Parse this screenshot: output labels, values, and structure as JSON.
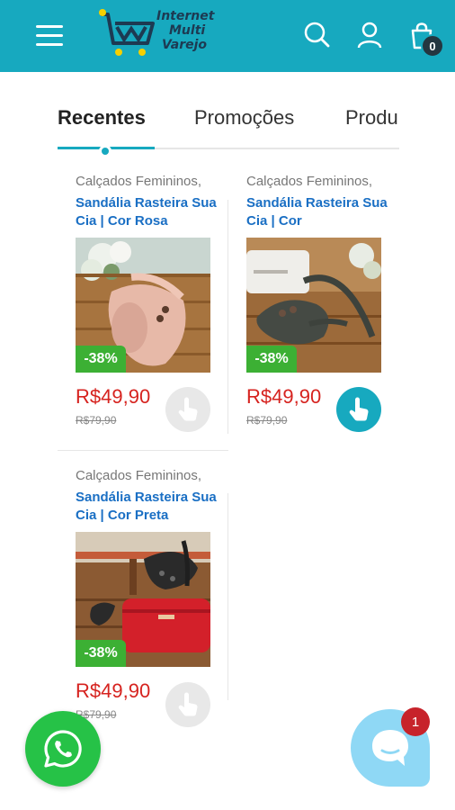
{
  "header": {
    "logo_line1": "Internet",
    "logo_line2": "Multi",
    "logo_line3": "Varejo",
    "cart_count": "0",
    "bg_color": "#17a9bf"
  },
  "tabs": [
    {
      "label": "Recentes",
      "active": true
    },
    {
      "label": "Promoções",
      "active": false
    },
    {
      "label": "Produ",
      "active": false
    }
  ],
  "products": [
    {
      "category": "Calçados Femininos,",
      "title": "Sandália Rasteira Sua Cia | Cor Rosa",
      "discount": "-38%",
      "price": "R$49,90",
      "old_price": "R$79,90",
      "button_state": "disabled",
      "image": "pink-sandal-photo"
    },
    {
      "category": "Calçados Femininos,",
      "title": "Sandália Rasteira Sua Cia | Cor",
      "discount": "-38%",
      "price": "R$49,90",
      "old_price": "R$79,90",
      "button_state": "enabled",
      "image": "dark-sandal-photo"
    },
    {
      "category": "Calçados Femininos,",
      "title": "Sandália Rasteira Sua Cia | Cor Preta",
      "discount": "-38%",
      "price": "R$49,90",
      "old_price": "R$79,90",
      "button_state": "disabled",
      "image": "black-sandal-photo"
    }
  ],
  "floating": {
    "whatsapp_icon": "whatsapp-icon",
    "chat_icon": "chat-bubble-icon",
    "chat_badge": "1"
  },
  "colors": {
    "accent": "#17a9bf",
    "price": "#d6231f",
    "discount": "#3cb034",
    "title_link": "#1a6fc4"
  }
}
